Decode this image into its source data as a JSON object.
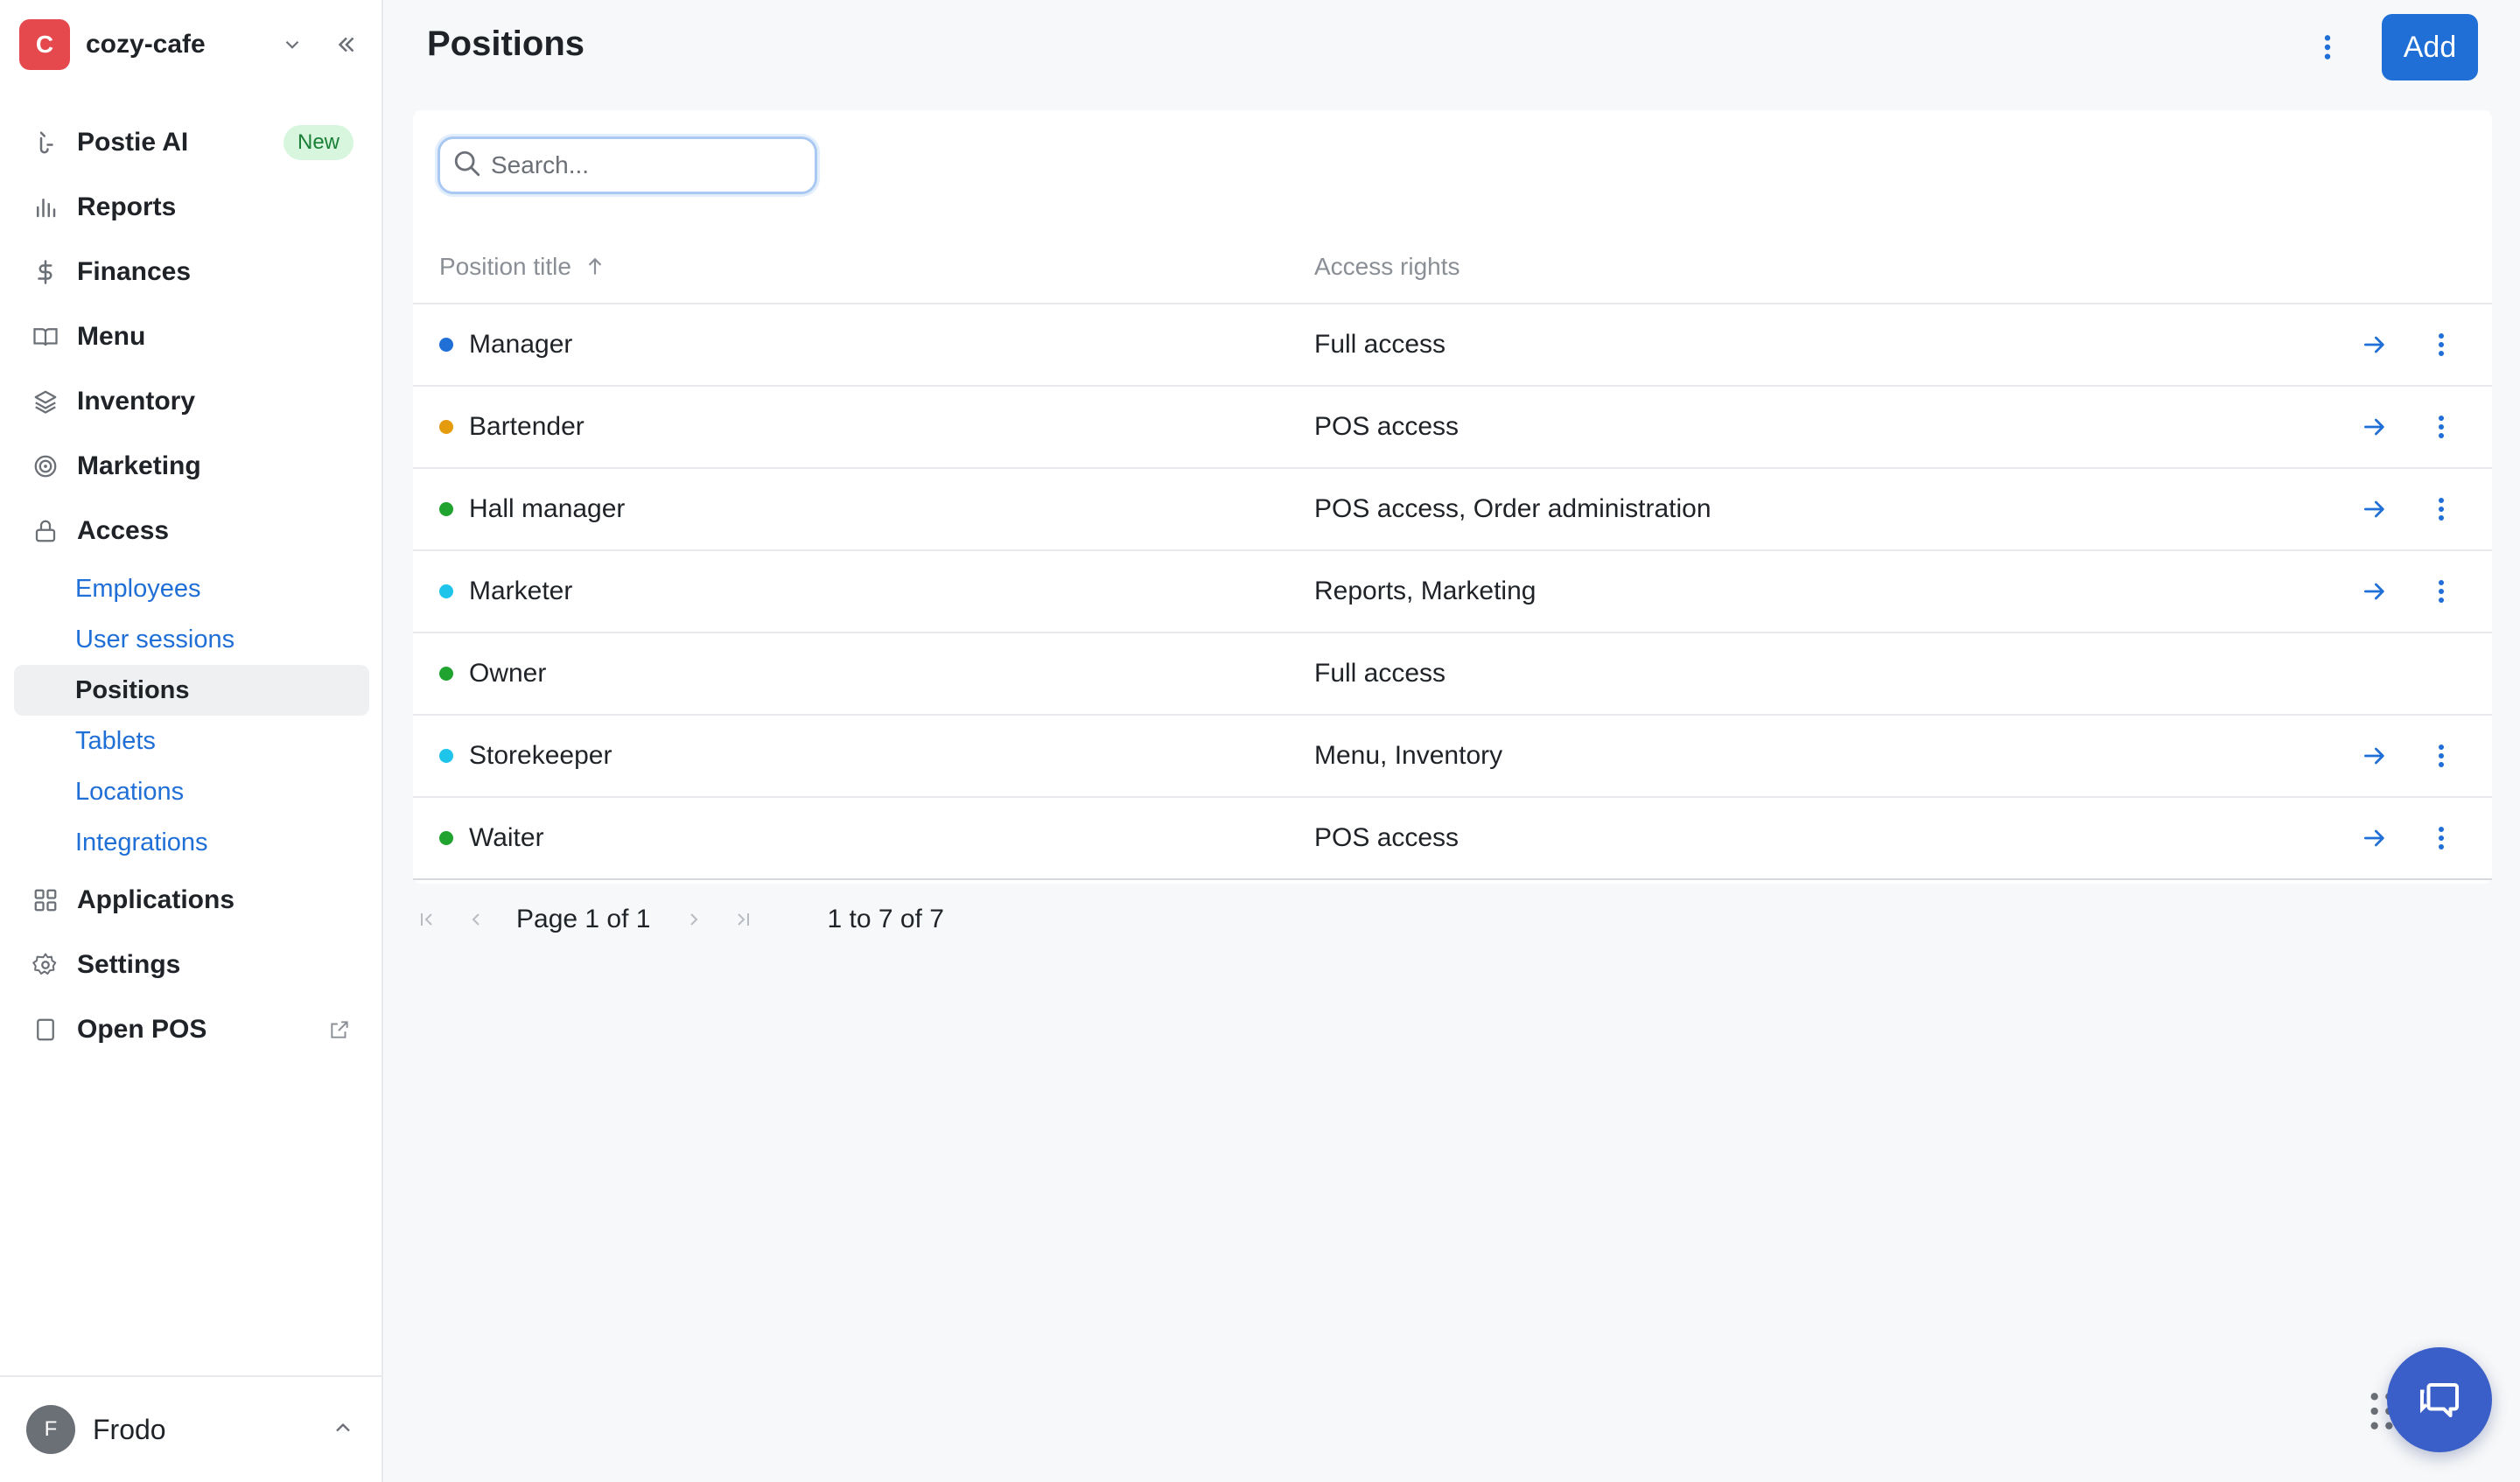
{
  "venue": {
    "initial": "C",
    "name": "cozy-cafe"
  },
  "nav": {
    "postie": {
      "label": "Postie AI",
      "badge": "New"
    },
    "reports": "Reports",
    "finances": "Finances",
    "menu": "Menu",
    "inventory": "Inventory",
    "marketing": "Marketing",
    "access": "Access",
    "access_sub": {
      "employees": "Employees",
      "user_sessions": "User sessions",
      "positions": "Positions",
      "tablets": "Tablets",
      "locations": "Locations",
      "integrations": "Integrations"
    },
    "applications": "Applications",
    "settings": "Settings",
    "open_pos": "Open POS"
  },
  "user": {
    "initial": "F",
    "name": "Frodo"
  },
  "header": {
    "title": "Positions",
    "add_label": "Add"
  },
  "search": {
    "placeholder": "Search...",
    "value": ""
  },
  "table": {
    "columns": {
      "title": "Position title",
      "rights": "Access rights"
    },
    "rows": [
      {
        "title": "Manager",
        "rights": "Full access",
        "color": "#1f6fd6",
        "actions": true
      },
      {
        "title": "Bartender",
        "rights": "POS access",
        "color": "#e59b0e",
        "actions": true
      },
      {
        "title": "Hall manager",
        "rights": "POS access, Order administration",
        "color": "#21a330",
        "actions": true
      },
      {
        "title": "Marketer",
        "rights": "Reports, Marketing",
        "color": "#1ec4ea",
        "actions": true
      },
      {
        "title": "Owner",
        "rights": "Full access",
        "color": "#21a330",
        "actions": false
      },
      {
        "title": "Storekeeper",
        "rights": "Menu, Inventory",
        "color": "#1ec4ea",
        "actions": true
      },
      {
        "title": "Waiter",
        "rights": "POS access",
        "color": "#21a330",
        "actions": true
      }
    ]
  },
  "pagination": {
    "page_text": "Page 1 of 1",
    "count_text": "1 to 7 of 7"
  },
  "colors": {
    "accent": "#1f6fd6",
    "chat": "#3b5fc8"
  }
}
